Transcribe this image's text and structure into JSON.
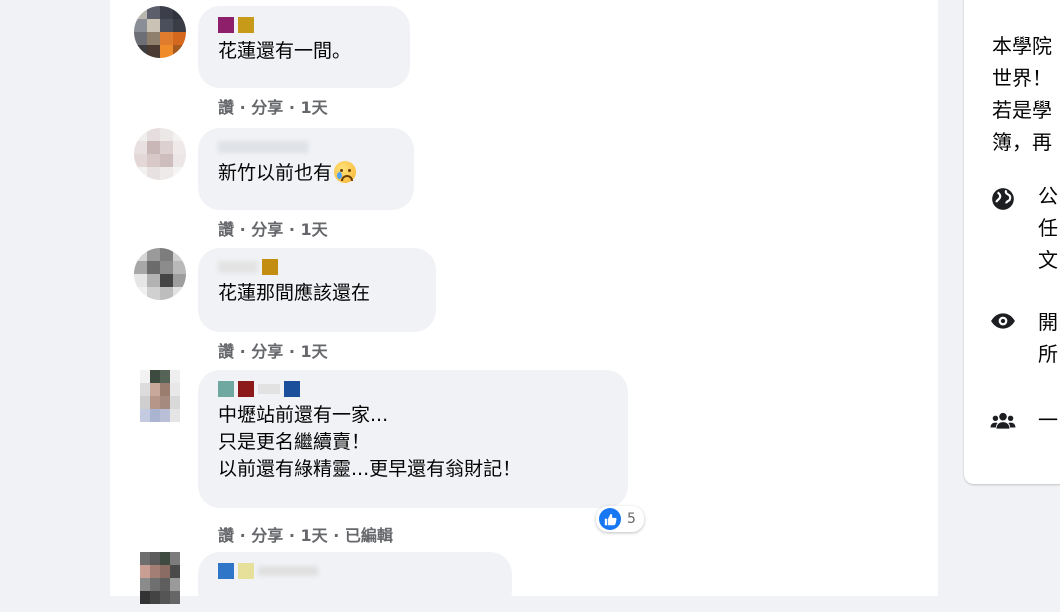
{
  "comments": [
    {
      "text": "花蓮還有一間。",
      "actions": {
        "like": "讚",
        "share": "分享",
        "time": "1天"
      }
    },
    {
      "text": "新竹以前也有",
      "actions": {
        "like": "讚",
        "share": "分享",
        "time": "1天"
      }
    },
    {
      "text": "花蓮那間應該還在",
      "actions": {
        "like": "讚",
        "share": "分享",
        "time": "1天"
      }
    },
    {
      "text": "中壢站前還有一家...\n只是更名繼續賣！\n以前還有綠精靈...更早還有翁財記！",
      "actions": {
        "like": "讚",
        "share": "分享",
        "time": "1天",
        "edited": "已編輯"
      },
      "reaction_count": "5"
    },
    {
      "text": ""
    }
  ],
  "sidebar": {
    "intro_text": "本學院\n世界！\n若是學\n簿，再",
    "public_label": "公\n任\n文",
    "visible_label": "開\n所",
    "members_label": "一"
  },
  "separator": "·",
  "colors": {
    "accent": "#1877f2",
    "bubble": "#f0f2f5",
    "meta": "#65676b"
  },
  "icons": [
    "globe-icon",
    "eye-icon",
    "group-icon",
    "like-icon",
    "crying-emoji-icon"
  ]
}
